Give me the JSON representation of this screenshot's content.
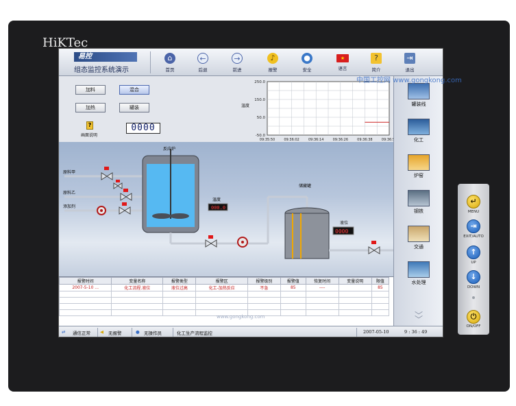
{
  "device": {
    "brand": "HiKTec"
  },
  "header": {
    "logo": "易控",
    "subtitle": "组态监控系统演示",
    "nav": [
      {
        "label": "首页",
        "icon": "home-icon"
      },
      {
        "label": "后退",
        "icon": "back-icon"
      },
      {
        "label": "前进",
        "icon": "forward-icon"
      },
      {
        "label": "报警",
        "icon": "alarm-icon"
      },
      {
        "label": "安全",
        "icon": "security-icon"
      },
      {
        "label": "语言",
        "icon": "flag-icon"
      },
      {
        "label": "简介",
        "icon": "intro-icon"
      },
      {
        "label": "退出",
        "icon": "exit-icon"
      }
    ]
  },
  "controls": {
    "buttons": [
      "加料",
      "混合",
      "加热",
      "罐装"
    ],
    "active": "混合",
    "help_label": "画面说明",
    "counter": "0000"
  },
  "trend": {
    "ylabel": "温度",
    "yticks": [
      "250.0",
      "150.0",
      "50.0",
      "-50.0"
    ],
    "xticks": [
      "09:35:50",
      "09:36:02",
      "09:36:14",
      "09:36:26",
      "09:36:38",
      "09:36:50"
    ],
    "line_color": "#cc2222"
  },
  "process": {
    "reactor_label": "反应炉",
    "storage_label": "储藏罐",
    "temp_label": "温度",
    "temp_value": "000.0",
    "level_label": "液位",
    "level_value": "0000",
    "inputs": [
      "原料甲",
      "原料乙",
      "添加剂"
    ]
  },
  "alarm_table": {
    "headers": [
      "报警时间",
      "变量名称",
      "报警类型",
      "报警区",
      "报警级别",
      "报警值",
      "恢复时间",
      "变量说明",
      "限值"
    ],
    "rows": [
      [
        "2007-5-10 ...",
        "化工流程.液位",
        "液位过高",
        "化工-加热反应",
        "不急",
        "85",
        "----",
        "",
        "85"
      ]
    ]
  },
  "side_panel": {
    "items": [
      {
        "label": "罐装线",
        "icon": "bottling-line-icon"
      },
      {
        "label": "化工",
        "icon": "chemical-icon"
      },
      {
        "label": "炉窑",
        "icon": "kiln-icon"
      },
      {
        "label": "钢铁",
        "icon": "steel-icon"
      },
      {
        "label": "交通",
        "icon": "traffic-icon"
      },
      {
        "label": "水处理",
        "icon": "water-treatment-icon"
      }
    ]
  },
  "status_bar": {
    "comm": "通信正常",
    "alarm": "无报警",
    "operator": "无操作员",
    "page": "化工生产流程监控",
    "date": "2007-05-10",
    "time": "9 : 36 : 49"
  },
  "keypad": [
    {
      "label": "MENU",
      "icon": "enter-icon"
    },
    {
      "label": "EXIT/AUTO",
      "icon": "exit-icon"
    },
    {
      "label": "UP",
      "icon": "up-arrow-icon"
    },
    {
      "label": "DOWN",
      "icon": "down-arrow-icon"
    },
    {
      "label": "ON/OFF",
      "icon": "power-icon"
    }
  ],
  "watermark": "中国工控网 www.gongkong.com",
  "watermark_footer": "www.gongkong.com"
}
